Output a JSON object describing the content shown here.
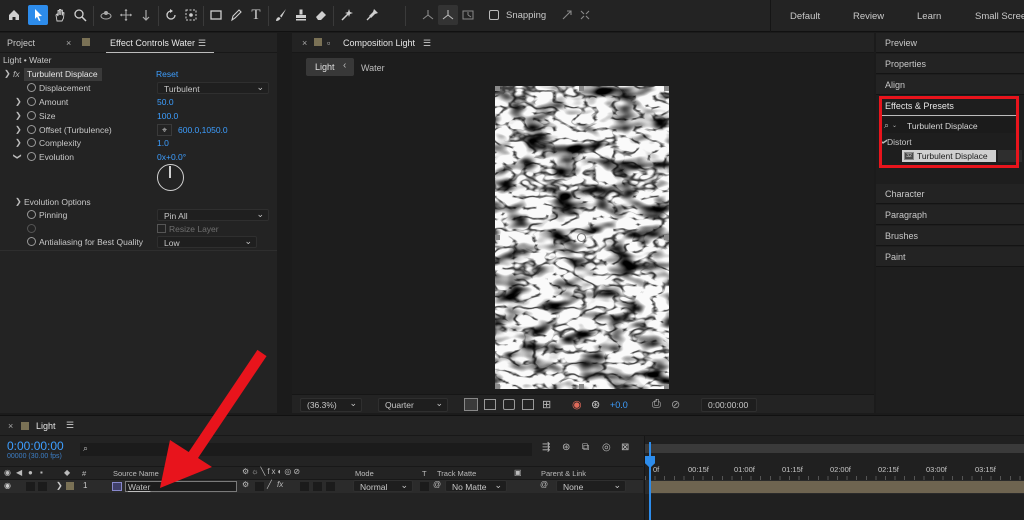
{
  "toolbar": {
    "tools": [
      "home-icon",
      "selection-arrow-icon",
      "hand-icon",
      "zoom-icon",
      "camera-orbit-icon",
      "move-icon",
      "dolly-icon",
      "rotate-icon",
      "anchor-icon",
      "rectangle-icon",
      "pen-icon",
      "type-icon",
      "brush-icon",
      "stamp-icon",
      "eraser-icon",
      "roto-icon",
      "puppet-icon"
    ],
    "snapping_label": "Snapping",
    "workspaces": [
      "Default",
      "Review",
      "Learn",
      "Small Screen"
    ]
  },
  "left_panel": {
    "tab_project": "Project",
    "tab_effect_controls": "Effect Controls Water",
    "breadcrumb": "Light • Water",
    "effect_name": "Turbulent Displace",
    "reset_label": "Reset",
    "properties": [
      {
        "name": "Displacement",
        "value": "Turbulent",
        "kind": "dropdown"
      },
      {
        "name": "Amount",
        "value": "50.0"
      },
      {
        "name": "Size",
        "value": "100.0"
      },
      {
        "name": "Offset (Turbulence)",
        "value": "600.0,1050.0"
      },
      {
        "name": "Complexity",
        "value": "1.0"
      },
      {
        "name": "Evolution",
        "value": "0x+0.0°"
      }
    ],
    "evolution_options_label": "Evolution Options",
    "pinning_label": "Pinning",
    "pinning_value": "Pin All",
    "resize_layer_label": "Resize Layer",
    "antialiasing_label": "Antialiasing for Best Quality",
    "antialiasing_value": "Low"
  },
  "composition": {
    "tab_label": "Composition Light",
    "breadcrumb_active": "Light",
    "breadcrumb_child": "Water",
    "zoom": "(36.3%)",
    "resolution": "Quarter",
    "exposure": "+0.0",
    "timecode": "0:00:00:00"
  },
  "right_panel": {
    "sections_top": [
      "Preview",
      "Properties",
      "Align"
    ],
    "effects_presets_label": "Effects & Presets",
    "search_value": "Turbulent Displace",
    "category": "Distort",
    "result": "Turbulent Displace",
    "sections_bottom": [
      "Character",
      "Paragraph",
      "Brushes",
      "Paint"
    ]
  },
  "timeline": {
    "tab_label": "Light",
    "timecode": "0:00:00:00",
    "fps_label": "00000 (30.00 fps)",
    "columns": {
      "number": "#",
      "source_name": "Source Name",
      "mode": "Mode",
      "t": "T",
      "track_matte": "Track Matte",
      "parent_link": "Parent & Link"
    },
    "ruler": [
      "0f",
      "00:15f",
      "01:00f",
      "01:15f",
      "02:00f",
      "02:15f",
      "03:00f",
      "03:15f"
    ],
    "layer": {
      "number": "1",
      "name": "Water",
      "mode": "Normal",
      "track_matte": "No Matte",
      "parent": "None"
    }
  },
  "colors": {
    "accent_blue": "#2d8ceb",
    "value_blue": "#3d9eff",
    "highlight_red": "#e8141c"
  }
}
